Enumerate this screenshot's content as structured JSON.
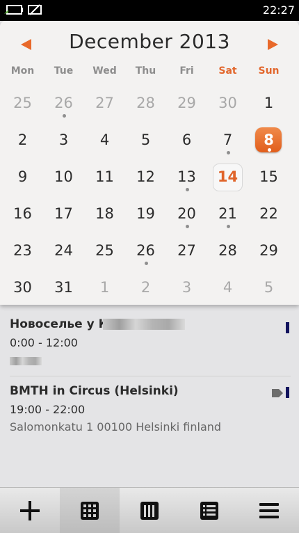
{
  "status_bar": {
    "time": "22:27"
  },
  "calendar": {
    "month_title": "December 2013",
    "weekdays": [
      "Mon",
      "Tue",
      "Wed",
      "Thu",
      "Fri",
      "Sat",
      "Sun"
    ],
    "weeks": [
      [
        "25",
        "26",
        "27",
        "28",
        "29",
        "30",
        "1"
      ],
      [
        "2",
        "3",
        "4",
        "5",
        "6",
        "7",
        "8"
      ],
      [
        "9",
        "10",
        "11",
        "12",
        "13",
        "14",
        "15"
      ],
      [
        "16",
        "17",
        "18",
        "19",
        "20",
        "21",
        "22"
      ],
      [
        "23",
        "24",
        "25",
        "26",
        "27",
        "28",
        "29"
      ],
      [
        "30",
        "31",
        "1",
        "2",
        "3",
        "4",
        "5"
      ]
    ],
    "selected_day": "8",
    "today": "14",
    "accent_color": "#e8692a"
  },
  "events": [
    {
      "title": "Новоселье у К",
      "time": "0:00 - 12:00",
      "calendar_color": "#12135e"
    },
    {
      "title": "BMTH in Circus (Helsinki)",
      "time": "19:00 - 22:00",
      "location": "Salomonkatu 1 00100 Helsinki finland",
      "calendar_color": "#12135e"
    }
  ],
  "toolbar": {
    "items": [
      "add-icon",
      "month-view-icon",
      "week-view-icon",
      "agenda-view-icon",
      "menu-icon"
    ]
  }
}
